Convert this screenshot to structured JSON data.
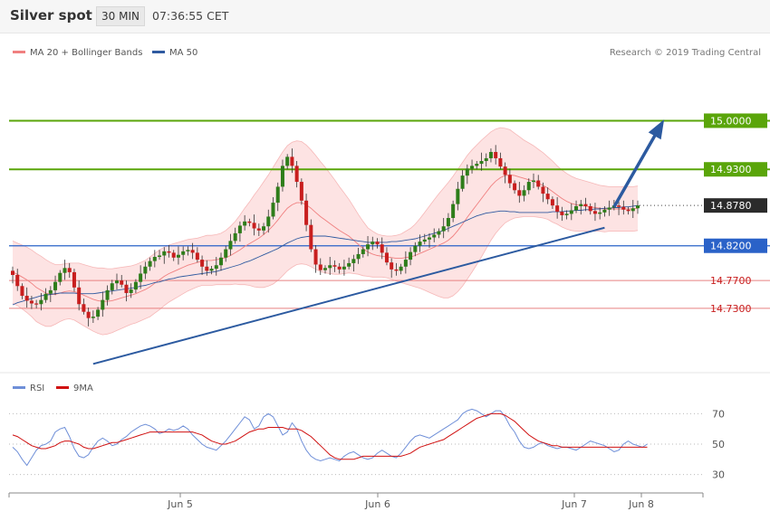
{
  "header": {
    "title": "Silver spot",
    "interval": "30 MIN",
    "time": "07:36:55 CET"
  },
  "legend": [
    {
      "label": "MA 20 + Bollinger Bands",
      "color": "#f08080"
    },
    {
      "label": "MA 50",
      "color": "#2f5aa0"
    }
  ],
  "credit": "Research © 2019 Trading Central",
  "colors": {
    "up": "#2e7d1a",
    "down": "#c81e1e",
    "target": "#5aa50a",
    "support": "#2a62c8",
    "resistance": "#e88080",
    "trend": "#2c5aa0",
    "band": "#fde3e3",
    "rsi": "#6f8fd8",
    "rsi_ma": "#d01010"
  },
  "chart_data": {
    "type": "candlestick",
    "instrument": "Silver spot",
    "timeframe": "30 MIN",
    "x_ticks": [
      "Jun 5",
      "Jun 6",
      "Jun 7",
      "Jun 8"
    ],
    "price_levels": [
      {
        "value": 15.0,
        "label": "15.0000",
        "role": "target"
      },
      {
        "value": 14.93,
        "label": "14.9300",
        "role": "target"
      },
      {
        "value": 14.878,
        "label": "14.8780",
        "role": "last"
      },
      {
        "value": 14.82,
        "label": "14.8200",
        "role": "support"
      },
      {
        "value": 14.77,
        "label": "14.7700",
        "role": "resistance"
      },
      {
        "value": 14.73,
        "label": "14.7300",
        "role": "resistance"
      }
    ],
    "price_ylim": [
      14.64,
      15.08
    ],
    "trendline": [
      {
        "bar": 17,
        "price": 14.65
      },
      {
        "bar": 125,
        "price": 14.846
      }
    ],
    "arrow": [
      {
        "bar": 127,
        "price": 14.876
      },
      {
        "bar": 137,
        "price": 14.995
      }
    ],
    "close": [
      14.778,
      14.762,
      14.748,
      14.741,
      14.737,
      14.736,
      14.742,
      14.751,
      14.756,
      14.768,
      14.781,
      14.788,
      14.782,
      14.76,
      14.736,
      14.725,
      14.716,
      14.718,
      14.728,
      14.742,
      14.756,
      14.766,
      14.77,
      14.764,
      14.752,
      14.757,
      14.768,
      14.78,
      14.79,
      14.798,
      14.804,
      14.806,
      14.812,
      14.81,
      14.803,
      14.807,
      14.812,
      14.814,
      14.81,
      14.8,
      14.79,
      14.784,
      14.787,
      14.792,
      14.803,
      14.815,
      14.827,
      14.838,
      14.849,
      14.855,
      14.853,
      14.845,
      14.842,
      14.848,
      14.862,
      14.882,
      14.905,
      14.935,
      14.948,
      14.935,
      14.912,
      14.885,
      14.85,
      14.815,
      14.793,
      14.785,
      14.788,
      14.792,
      14.79,
      14.786,
      14.79,
      14.795,
      14.801,
      14.808,
      14.815,
      14.822,
      14.826,
      14.822,
      14.81,
      14.796,
      14.786,
      14.784,
      14.79,
      14.8,
      14.811,
      14.82,
      14.826,
      14.829,
      14.832,
      14.836,
      14.841,
      14.848,
      14.86,
      14.88,
      14.902,
      14.921,
      14.931,
      14.935,
      14.938,
      14.942,
      14.946,
      14.955,
      14.946,
      14.934,
      14.922,
      14.91,
      14.9,
      14.892,
      14.9,
      14.912,
      14.914,
      14.905,
      14.895,
      14.887,
      14.878,
      14.869,
      14.864,
      14.866,
      14.871,
      14.877,
      14.88,
      14.877,
      14.87,
      14.866,
      14.868,
      14.872,
      14.875,
      14.878,
      14.876,
      14.872,
      14.87,
      14.874,
      14.878
    ],
    "ma20": [
      14.782,
      14.779,
      14.775,
      14.771,
      14.766,
      14.76,
      14.756,
      14.752,
      14.75,
      14.75,
      14.752,
      14.754,
      14.755,
      14.754,
      14.752,
      14.749,
      14.746,
      14.743,
      14.741,
      14.74,
      14.74,
      14.741,
      14.743,
      14.745,
      14.747,
      14.749,
      14.751,
      14.754,
      14.757,
      14.761,
      14.766,
      14.771,
      14.776,
      14.78,
      14.783,
      14.786,
      14.789,
      14.792,
      14.794,
      14.796,
      14.798,
      14.799,
      14.799,
      14.8,
      14.801,
      14.803,
      14.806,
      14.81,
      14.814,
      14.819,
      14.823,
      14.827,
      14.831,
      14.836,
      14.842,
      14.849,
      14.857,
      14.866,
      14.874,
      14.879,
      14.882,
      14.882,
      14.879,
      14.874,
      14.868,
      14.862,
      14.857,
      14.852,
      14.847,
      14.842,
      14.838,
      14.834,
      14.828,
      14.822,
      14.816,
      14.811,
      14.808,
      14.806,
      14.805,
      14.804,
      14.803,
      14.802,
      14.802,
      14.803,
      14.804,
      14.806,
      14.809,
      14.812,
      14.815,
      14.818,
      14.821,
      14.824,
      14.828,
      14.834,
      14.842,
      14.851,
      14.861,
      14.87,
      14.879,
      14.888,
      14.897,
      14.906,
      14.913,
      14.918,
      14.921,
      14.922,
      14.921,
      14.919,
      14.917,
      14.915,
      14.913,
      14.91,
      14.907,
      14.903,
      14.898,
      14.893,
      14.888,
      14.884,
      14.881,
      14.879,
      14.878,
      14.877,
      14.876,
      14.875,
      14.874,
      14.873,
      14.873,
      14.873,
      14.873,
      14.873,
      14.873,
      14.873,
      14.874
    ],
    "ma50": [
      14.735,
      14.738,
      14.74,
      14.742,
      14.744,
      14.746,
      14.748,
      14.749,
      14.75,
      14.751,
      14.752,
      14.752,
      14.752,
      14.752,
      14.751,
      14.751,
      14.751,
      14.751,
      14.752,
      14.753,
      14.754,
      14.755,
      14.756,
      14.757,
      14.758,
      14.759,
      14.76,
      14.762,
      14.763,
      14.765,
      14.767,
      14.768,
      14.77,
      14.772,
      14.773,
      14.775,
      14.776,
      14.777,
      14.778,
      14.779,
      14.78,
      14.781,
      14.782,
      14.783,
      14.785,
      14.787,
      14.789,
      14.791,
      14.793,
      14.796,
      14.798,
      14.801,
      14.804,
      14.807,
      14.81,
      14.813,
      14.816,
      14.82,
      14.824,
      14.827,
      14.83,
      14.832,
      14.833,
      14.834,
      14.834,
      14.834,
      14.834,
      14.833,
      14.832,
      14.831,
      14.83,
      14.829,
      14.828,
      14.827,
      14.826,
      14.825,
      14.825,
      14.825,
      14.825,
      14.825,
      14.826,
      14.826,
      14.827,
      14.828,
      14.829,
      14.83,
      14.832,
      14.834,
      14.836,
      14.838,
      14.84,
      14.842,
      14.845,
      14.848,
      14.851,
      14.854,
      14.857,
      14.86,
      14.863,
      14.865,
      14.867,
      14.868,
      14.869,
      14.87,
      14.87,
      14.869,
      14.869,
      14.868,
      14.868,
      14.868,
      14.868,
      14.868,
      14.868,
      14.868,
      14.869,
      14.869,
      14.869,
      14.87,
      14.87,
      14.871,
      14.871,
      14.872,
      14.872,
      14.873,
      14.873,
      14.874,
      14.874,
      14.875,
      14.875,
      14.876,
      14.876,
      14.877,
      14.878
    ],
    "bb_width": [
      0.045,
      0.045,
      0.046,
      0.047,
      0.048,
      0.049,
      0.049,
      0.048,
      0.046,
      0.043,
      0.041,
      0.04,
      0.04,
      0.041,
      0.043,
      0.044,
      0.045,
      0.046,
      0.047,
      0.048,
      0.047,
      0.046,
      0.045,
      0.044,
      0.043,
      0.042,
      0.042,
      0.042,
      0.042,
      0.043,
      0.043,
      0.043,
      0.042,
      0.041,
      0.04,
      0.039,
      0.038,
      0.037,
      0.036,
      0.035,
      0.035,
      0.036,
      0.036,
      0.036,
      0.037,
      0.039,
      0.042,
      0.045,
      0.05,
      0.055,
      0.06,
      0.066,
      0.071,
      0.076,
      0.08,
      0.084,
      0.087,
      0.089,
      0.09,
      0.09,
      0.089,
      0.088,
      0.086,
      0.084,
      0.082,
      0.079,
      0.076,
      0.072,
      0.068,
      0.063,
      0.058,
      0.053,
      0.048,
      0.043,
      0.039,
      0.035,
      0.033,
      0.031,
      0.03,
      0.03,
      0.031,
      0.033,
      0.035,
      0.038,
      0.041,
      0.045,
      0.05,
      0.056,
      0.062,
      0.068,
      0.074,
      0.079,
      0.083,
      0.086,
      0.088,
      0.089,
      0.089,
      0.088,
      0.086,
      0.084,
      0.081,
      0.078,
      0.075,
      0.072,
      0.068,
      0.065,
      0.061,
      0.058,
      0.055,
      0.053,
      0.051,
      0.049,
      0.047,
      0.045,
      0.044,
      0.042,
      0.041,
      0.04,
      0.039,
      0.038,
      0.037,
      0.036,
      0.035,
      0.034,
      0.033,
      0.033,
      0.032,
      0.032,
      0.032,
      0.032,
      0.032,
      0.032,
      0.032,
      0.032
    ],
    "rsi": [
      48,
      45,
      40,
      36,
      41,
      46,
      49,
      50,
      52,
      58,
      60,
      61,
      55,
      47,
      42,
      41,
      43,
      48,
      52,
      54,
      52,
      49,
      50,
      53,
      55,
      58,
      60,
      62,
      63,
      62,
      60,
      57,
      58,
      60,
      59,
      60,
      62,
      60,
      56,
      53,
      50,
      48,
      47,
      46,
      49,
      52,
      56,
      60,
      64,
      68,
      66,
      60,
      62,
      68,
      70,
      68,
      62,
      56,
      58,
      64,
      60,
      52,
      46,
      42,
      40,
      39,
      40,
      41,
      40,
      39,
      42,
      44,
      45,
      43,
      41,
      40,
      41,
      44,
      46,
      44,
      42,
      41,
      44,
      48,
      52,
      55,
      56,
      55,
      54,
      56,
      58,
      60,
      62,
      64,
      66,
      70,
      72,
      73,
      72,
      70,
      68,
      70,
      72,
      72,
      68,
      62,
      58,
      52,
      48,
      47,
      48,
      50,
      51,
      49,
      48,
      47,
      48,
      48,
      47,
      46,
      48,
      50,
      52,
      51,
      50,
      49,
      47,
      45,
      46,
      50,
      52,
      50,
      49,
      48,
      50
    ],
    "rsi_ma": [
      56,
      55,
      53,
      51,
      49,
      48,
      47,
      47,
      48,
      49,
      51,
      52,
      52,
      51,
      50,
      48,
      47,
      47,
      48,
      49,
      50,
      51,
      51,
      52,
      53,
      54,
      55,
      56,
      57,
      58,
      58,
      58,
      58,
      58,
      58,
      58,
      58,
      58,
      58,
      57,
      56,
      54,
      52,
      51,
      50,
      50,
      51,
      52,
      54,
      56,
      58,
      59,
      60,
      60,
      61,
      61,
      61,
      61,
      60,
      60,
      60,
      59,
      57,
      55,
      52,
      49,
      46,
      43,
      41,
      40,
      40,
      40,
      40,
      41,
      42,
      42,
      42,
      42,
      42,
      42,
      42,
      42,
      42,
      43,
      44,
      46,
      48,
      49,
      50,
      51,
      52,
      53,
      55,
      57,
      59,
      61,
      63,
      65,
      67,
      68,
      69,
      70,
      70,
      70,
      69,
      67,
      65,
      62,
      59,
      56,
      54,
      52,
      51,
      50,
      49,
      49,
      48,
      48,
      48,
      48,
      48,
      48,
      48,
      48,
      48,
      48,
      48,
      48,
      48,
      48,
      48,
      48,
      48,
      48,
      48
    ],
    "rsi_ylim": [
      22,
      78
    ],
    "rsi_levels": [
      70,
      50,
      30
    ]
  }
}
